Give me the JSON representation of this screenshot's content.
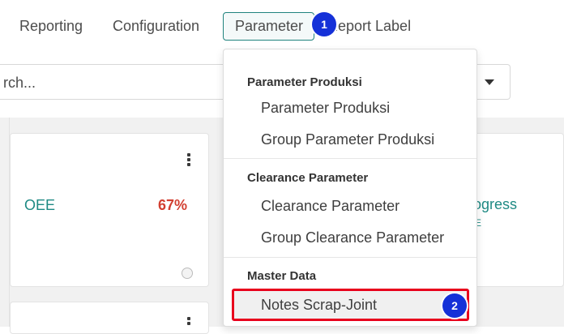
{
  "topnav": {
    "items": [
      "Reporting",
      "Configuration",
      "Parameter",
      "Report Label"
    ]
  },
  "search": {
    "value": "rch..."
  },
  "card": {
    "metric_label": "OEE",
    "metric_value": "67%"
  },
  "right_card": {
    "status_text": "rogress",
    "status_sub": "E"
  },
  "dropdown": {
    "sections": [
      {
        "header": "Parameter Produksi",
        "items": [
          "Parameter Produksi",
          "Group Parameter Produksi"
        ]
      },
      {
        "header": "Clearance Parameter",
        "items": [
          "Clearance Parameter",
          "Group Clearance Parameter"
        ]
      },
      {
        "header": "Master Data",
        "items": [
          "Notes Scrap-Joint"
        ]
      }
    ]
  },
  "annotations": {
    "badge1": "1",
    "badge2": "2"
  },
  "colors": {
    "accent": "#20837d",
    "value_red": "#d23f31",
    "badge_blue": "#1531d8",
    "highlight_red": "#e8001c"
  }
}
